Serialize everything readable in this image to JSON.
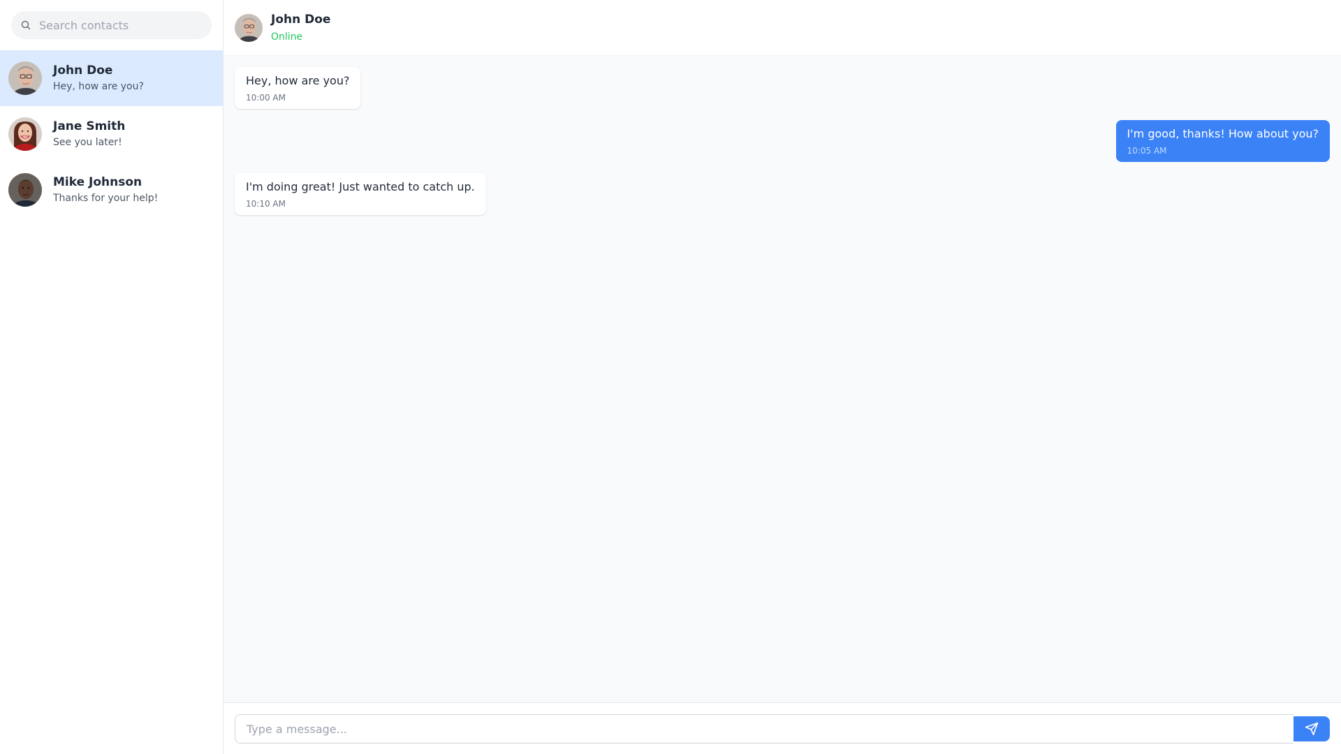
{
  "search": {
    "placeholder": "Search contacts",
    "icon": "search-icon"
  },
  "contacts": [
    {
      "name": "John Doe",
      "preview": "Hey, how are you?",
      "active": true
    },
    {
      "name": "Jane Smith",
      "preview": "See you later!",
      "active": false
    },
    {
      "name": "Mike Johnson",
      "preview": "Thanks for your help!",
      "active": false
    }
  ],
  "chat": {
    "name": "John Doe",
    "status": "Online",
    "messages": [
      {
        "direction": "in",
        "text": "Hey, how are you?",
        "time": "10:00 AM"
      },
      {
        "direction": "out",
        "text": "I'm good, thanks! How about you?",
        "time": "10:05 AM"
      },
      {
        "direction": "in",
        "text": "I'm doing great! Just wanted to catch up.",
        "time": "10:10 AM"
      }
    ]
  },
  "composer": {
    "placeholder": "Type a message...",
    "send_icon": "send-icon"
  },
  "colors": {
    "accent": "#3b82f6",
    "active_contact_bg": "#dbeafe",
    "online": "#22c55e",
    "chat_bg": "#f9fafb"
  }
}
